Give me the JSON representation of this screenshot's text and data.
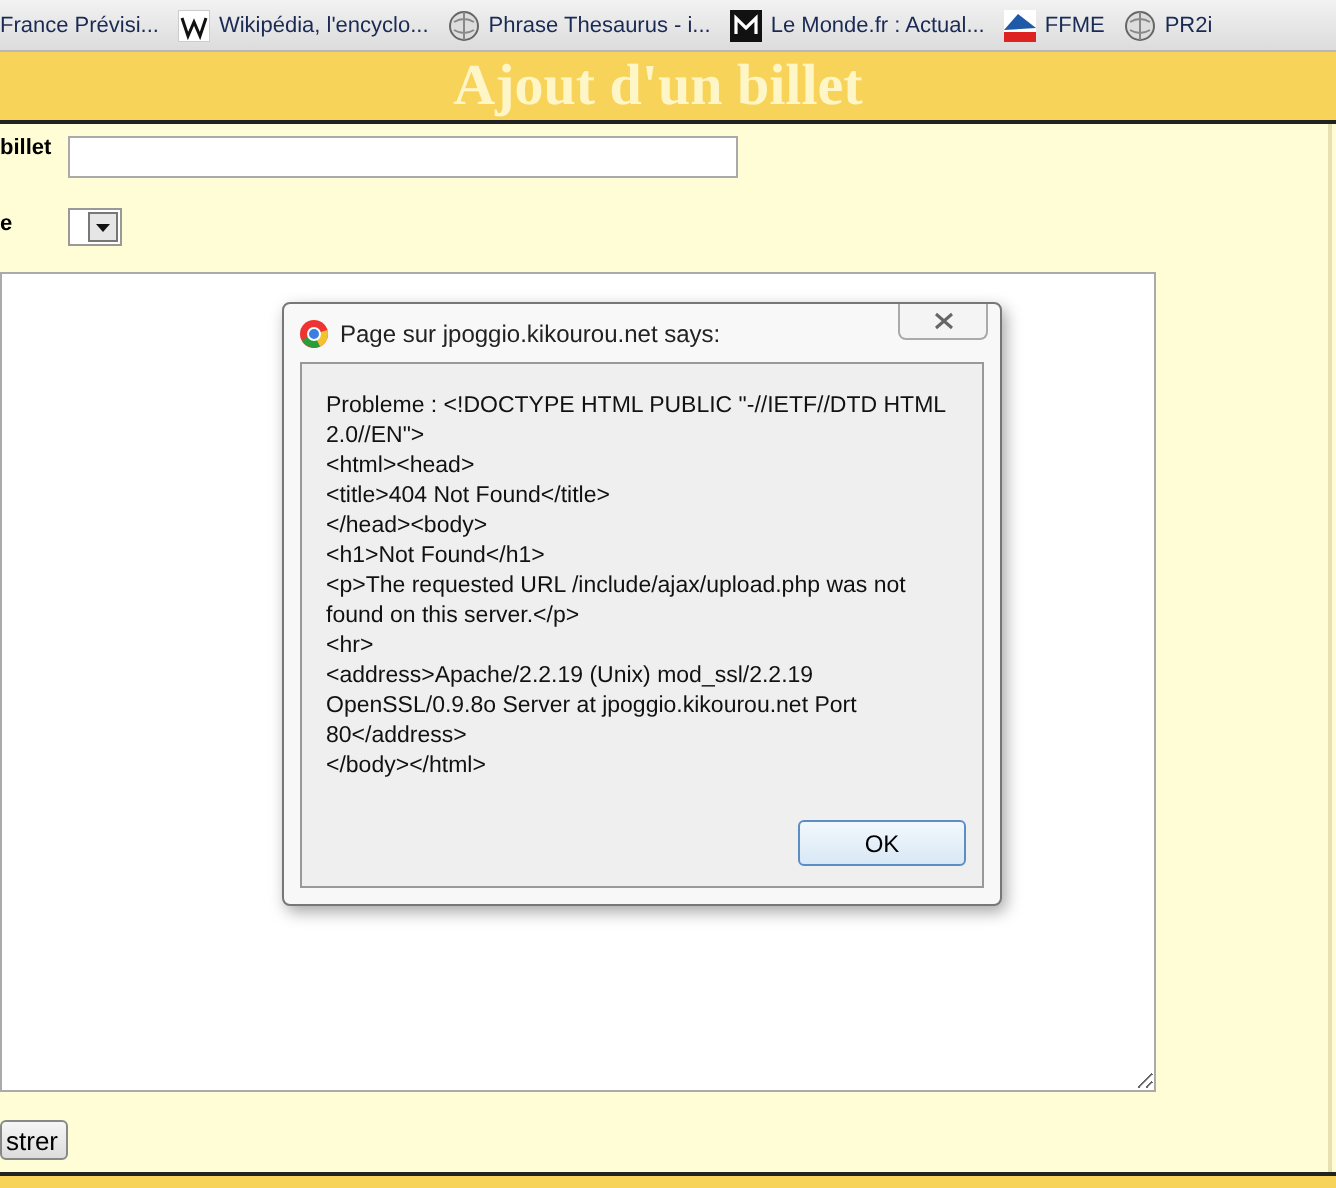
{
  "bookmarks_bar": [
    {
      "label": "France Prévisi...",
      "kind": "plain"
    },
    {
      "label": "Wikipédia, l'encyclo...",
      "kind": "wiki"
    },
    {
      "label": "Phrase Thesaurus - i...",
      "kind": "site"
    },
    {
      "label": "Le Monde.fr : Actual...",
      "kind": "news"
    },
    {
      "label": "FFME",
      "kind": "club"
    },
    {
      "label": "PR2i",
      "kind": "site"
    }
  ],
  "header": {
    "title": "Ajout d'un billet"
  },
  "form": {
    "title_label": "billet",
    "select_label": "e",
    "submit_button": "strer"
  },
  "dialog": {
    "title": "Page sur jpoggio.kikourou.net says:",
    "message_lines": [
      "Probleme : <!DOCTYPE HTML PUBLIC \"-//IETF//DTD HTML 2.0//EN\">",
      "<html><head>",
      "<title>404 Not Found</title>",
      "</head><body>",
      "<h1>Not Found</h1>",
      "<p>The requested URL /include/ajax/upload.php was not found on this server.</p>",
      "<hr>",
      "<address>Apache/2.2.19 (Unix) mod_ssl/2.2.19 OpenSSL/0.9.8o Server at jpoggio.kikourou.net Port 80</address>",
      "</body></html>"
    ],
    "ok_button": "OK"
  }
}
